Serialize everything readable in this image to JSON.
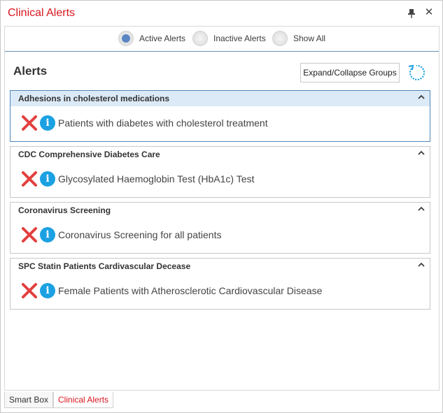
{
  "window": {
    "title": "Clinical Alerts"
  },
  "filters": {
    "options": [
      {
        "label": "Active Alerts",
        "selected": true
      },
      {
        "label": "Inactive Alerts",
        "selected": false
      },
      {
        "label": "Show All",
        "selected": false
      }
    ]
  },
  "main": {
    "heading": "Alerts",
    "expand_label": "Expand/Collapse Groups"
  },
  "groups": [
    {
      "title": "Adhesions in cholesterol medications",
      "alert": "Patients with diabetes with cholesterol treatment"
    },
    {
      "title": "CDC Comprehensive Diabetes Care",
      "alert": "Glycosylated Haemoglobin Test (HbA1c) Test"
    },
    {
      "title": "Coronavirus Screening",
      "alert": "Coronavirus Screening for all patients"
    },
    {
      "title": "SPC Statin Patients Cardivascular Decease",
      "alert": "Female Patients with Atherosclerotic Cardiovascular Disease"
    }
  ],
  "tabs": [
    {
      "label": "Smart Box",
      "active": false
    },
    {
      "label": "Clinical Alerts",
      "active": true
    }
  ],
  "colors": {
    "accent_red": "#d9161e",
    "info_blue": "#1ba1e2",
    "radio_selected": "#5b86c2",
    "selected_group_header": "#dceaf7"
  },
  "icons": [
    "pin-icon",
    "close-icon",
    "refresh-icon",
    "chevron-up-icon",
    "dismiss-x-icon",
    "info-icon"
  ]
}
